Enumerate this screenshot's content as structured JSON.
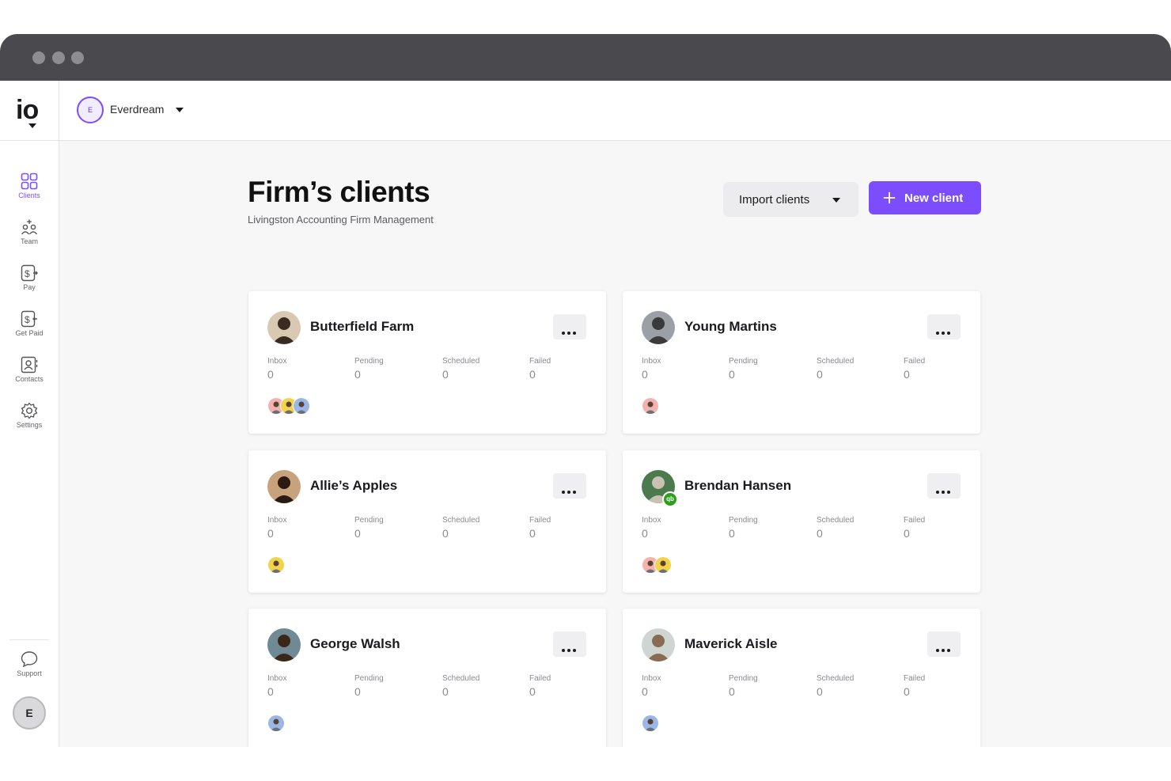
{
  "app": {
    "logo_text": "io",
    "org": {
      "initial": "E",
      "name": "Everdream"
    }
  },
  "sidebar": {
    "items": [
      {
        "label": "Clients",
        "icon": "grid-icon",
        "active": true
      },
      {
        "label": "Team",
        "icon": "team-icon",
        "active": false
      },
      {
        "label": "Pay",
        "icon": "pay-icon",
        "active": false
      },
      {
        "label": "Get Paid",
        "icon": "get-paid-icon",
        "active": false
      },
      {
        "label": "Contacts",
        "icon": "contacts-icon",
        "active": false
      },
      {
        "label": "Settings",
        "icon": "gear-icon",
        "active": false
      }
    ],
    "support_label": "Support",
    "user_initial": "E"
  },
  "page": {
    "title": "Firm’s clients",
    "subtitle": "Livingston Accounting Firm Management",
    "import_label": "Import clients",
    "new_label": "New client"
  },
  "stat_labels": [
    "Inbox",
    "Pending",
    "Scheduled",
    "Failed"
  ],
  "clients": [
    {
      "name": "Butterfield Farm",
      "stats": [
        "0",
        "0",
        "0",
        "0"
      ],
      "members": 3
    },
    {
      "name": "Young Martins",
      "stats": [
        "0",
        "0",
        "0",
        "0"
      ],
      "members": 1
    },
    {
      "name": "Allie’s Apples",
      "stats": [
        "0",
        "0",
        "0",
        "0"
      ],
      "members": 1
    },
    {
      "name": "Brendan Hansen",
      "stats": [
        "0",
        "0",
        "0",
        "0"
      ],
      "members": 2,
      "badge": "qb"
    },
    {
      "name": "George Walsh",
      "stats": [
        "0",
        "0",
        "0",
        "0"
      ],
      "members": 1
    },
    {
      "name": "Maverick Aisle",
      "stats": [
        "0",
        "0",
        "0",
        "0"
      ],
      "members": 1
    }
  ],
  "colors": {
    "accent": "#7c4dff",
    "titlebar": "#4a494e",
    "background": "#f7f7f8"
  }
}
